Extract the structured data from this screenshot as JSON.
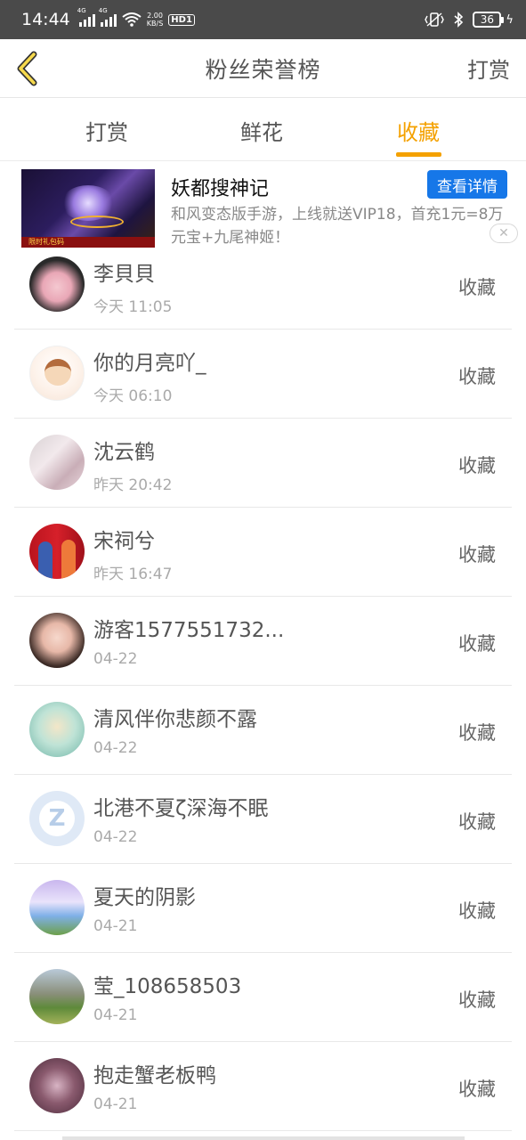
{
  "status_bar": {
    "time": "14:44",
    "net_tag_1": "4G",
    "net_tag_2": "4G",
    "speed_value": "2.00",
    "speed_unit": "KB/S",
    "hd": "HD",
    "hd_sub": "1",
    "battery": "36"
  },
  "nav": {
    "title": "粉丝荣誉榜",
    "right_action": "打赏"
  },
  "tabs": [
    {
      "label": "打赏",
      "active": false
    },
    {
      "label": "鲜花",
      "active": false
    },
    {
      "label": "收藏",
      "active": true
    }
  ],
  "accent_color": "#f4a100",
  "ad": {
    "title": "妖都搜神记",
    "description": "和风变态版手游，上线就送VIP18，首充1元=8万元宝+九尾神姬！",
    "button": "查看详情",
    "image_caption": "限时礼包码",
    "button_color": "#1677e8"
  },
  "list": [
    {
      "name": "李貝貝",
      "time": "今天 11:05",
      "action": "收藏"
    },
    {
      "name": "你的月亮吖_",
      "time": "今天 06:10",
      "action": "收藏"
    },
    {
      "name": "沈云鹤",
      "time": "昨天 20:42",
      "action": "收藏"
    },
    {
      "name": "宋祠兮",
      "time": "昨天 16:47",
      "action": "收藏"
    },
    {
      "name": "游客1577551732...",
      "time": "04-22",
      "action": "收藏"
    },
    {
      "name": "清风伴你悲颜不露",
      "time": "04-22",
      "action": "收藏"
    },
    {
      "name": "北港不夏ζ深海不眠",
      "time": "04-22",
      "action": "收藏"
    },
    {
      "name": "夏天的阴影",
      "time": "04-21",
      "action": "收藏"
    },
    {
      "name": "莹_108658503",
      "time": "04-21",
      "action": "收藏"
    },
    {
      "name": "抱走蟹老板鸭",
      "time": "04-21",
      "action": "收藏"
    }
  ]
}
